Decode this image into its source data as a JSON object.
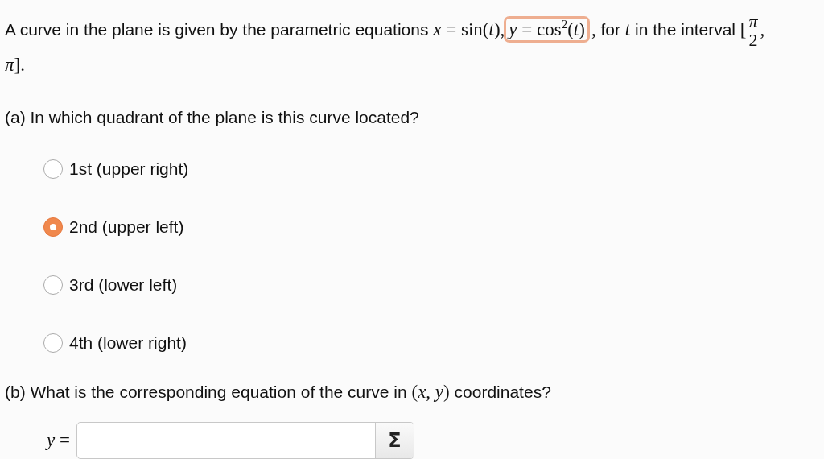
{
  "intro": {
    "segments": [
      {
        "kind": "text",
        "text": "A curve in the plane is given by the parametric equations "
      },
      {
        "kind": "math",
        "text": "*x* = sin(*t*),"
      },
      {
        "kind": "highlight",
        "text": "*y* = cos$^{2}$(*t*)"
      },
      {
        "kind": "math",
        "text": ","
      },
      {
        "kind": "text",
        "text": " for "
      },
      {
        "kind": "math",
        "text": "*t*"
      },
      {
        "kind": "text",
        "text": " in the interval "
      },
      {
        "kind": "math",
        "text": "["
      },
      {
        "kind": "fraction",
        "numerator": "π",
        "denominator": "2"
      },
      {
        "kind": "math",
        "text": ", *π*]."
      }
    ]
  },
  "part_a": {
    "question": "(a) In which quadrant of the plane is this curve located?",
    "options": [
      {
        "label": "1st (upper right)",
        "selected": false
      },
      {
        "label": "2nd (upper left)",
        "selected": true
      },
      {
        "label": "3rd (lower left)",
        "selected": false
      },
      {
        "label": "4th (lower right)",
        "selected": false
      }
    ]
  },
  "part_b": {
    "question": [
      {
        "kind": "text",
        "text": "(b) What is the corresponding equation of the curve in "
      },
      {
        "kind": "math",
        "text": "(*x*, *y*)"
      },
      {
        "kind": "text",
        "text": " coordinates?"
      }
    ],
    "answer_label": "*y* =",
    "equation_button": "Σ"
  }
}
